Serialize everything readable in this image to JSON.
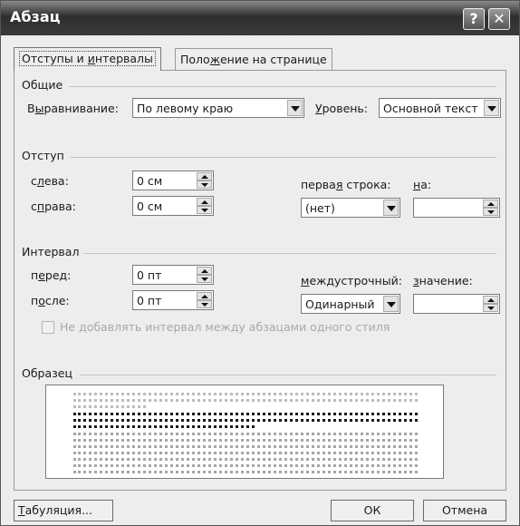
{
  "window": {
    "title": "Абзац",
    "help_label": "?",
    "close_label": "✕"
  },
  "tabs": [
    {
      "label_pre": "Отступы и ",
      "label_acc": "и",
      "label_post": "нтервалы"
    },
    {
      "label_pre": "Поло",
      "label_acc": "ж",
      "label_post": "ение на странице"
    }
  ],
  "general": {
    "heading": "Общие",
    "alignment_label_pre": "В",
    "alignment_label_acc": "ы",
    "alignment_label_post": "равнивание:",
    "alignment_value": "По левому краю",
    "level_label_acc": "У",
    "level_label_post": "ровень:",
    "level_value": "Основной текст"
  },
  "indent": {
    "heading": "Отступ",
    "left_label_pre": "с",
    "left_label_acc": "л",
    "left_label_post": "ева:",
    "left_value": "0 см",
    "right_label_pre": "с",
    "right_label_acc": "п",
    "right_label_post": "рава:",
    "right_value": "0 см",
    "first_line_label_pre": "перва",
    "first_line_label_acc": "я",
    "first_line_label_post": " строка:",
    "first_line_value": "(нет)",
    "by_label_acc": "н",
    "by_label_post": "а:",
    "by_value": ""
  },
  "spacing": {
    "heading": "Интервал",
    "before_label_pre": "п",
    "before_label_acc": "е",
    "before_label_post": "ред:",
    "before_value": "0 пт",
    "after_label_pre": "п",
    "after_label_acc": "о",
    "after_label_post": "сле:",
    "after_value": "0 пт",
    "line_label_acc": "м",
    "line_label_post": "еждустрочный:",
    "line_value": "Одинарный",
    "at_label_acc": "з",
    "at_label_post": "начение:",
    "at_value": "",
    "no_space_same_style_label": "Не добавлять интервал между абзацами одного стиля",
    "no_space_same_style_checked": false
  },
  "preview": {
    "heading": "Образец"
  },
  "footer": {
    "tabs_button_acc": "Т",
    "tabs_button_post": "абуляция...",
    "ok_label": "ОК",
    "cancel_label": "Отмена"
  }
}
